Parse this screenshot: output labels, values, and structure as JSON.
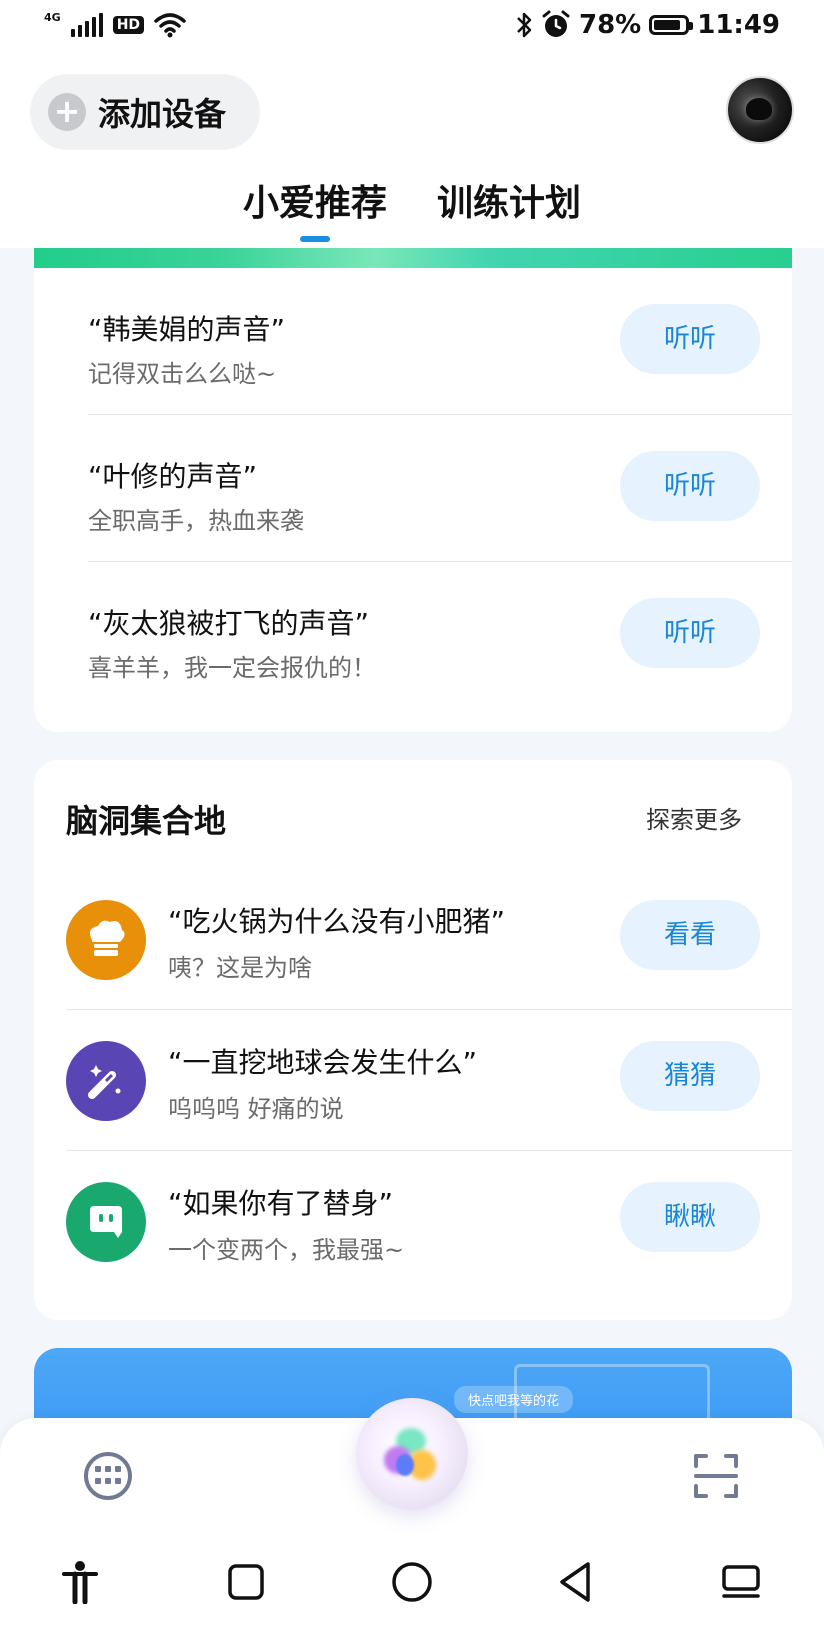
{
  "status_bar": {
    "network": "4G",
    "hd": "HD",
    "battery": "78%",
    "time": "11:49"
  },
  "header": {
    "add_device_label": "添加设备",
    "tabs": [
      {
        "label": "小爱推荐",
        "active": true
      },
      {
        "label": "训练计划",
        "active": false
      }
    ]
  },
  "voice_list": [
    {
      "title": "“韩美娟的声音”",
      "subtitle": "记得双击么么哒~",
      "button": "听听"
    },
    {
      "title": "“叶修的声音”",
      "subtitle": "全职高手，热血来袭",
      "button": "听听"
    },
    {
      "title": "“灰太狼被打飞的声音”",
      "subtitle": "喜羊羊，我一定会报仇的！",
      "button": "听听"
    }
  ],
  "brainstorm": {
    "title": "脑洞集合地",
    "more_label": "探索更多",
    "items": [
      {
        "title": "“吃火锅为什么没有小肥猪”",
        "subtitle": "咦？这是为啥",
        "button": "看看",
        "icon": "chef-hat-icon",
        "color": "#e8900a"
      },
      {
        "title": "“一直挖地球会发生什么”",
        "subtitle": "呜呜呜 好痛的说",
        "button": "猜猜",
        "icon": "magic-wand-icon",
        "color": "#5a45b5"
      },
      {
        "title": "“如果你有了替身”",
        "subtitle": "一个变两个，我最强~",
        "button": "瞅瞅",
        "icon": "chat-bubble-icon",
        "color": "#19a86e"
      }
    ]
  },
  "banner": {
    "chip_text": "快点吧我等的花"
  },
  "colors": {
    "accent": "#1a86d6",
    "button_bg": "#e6f2fd"
  }
}
